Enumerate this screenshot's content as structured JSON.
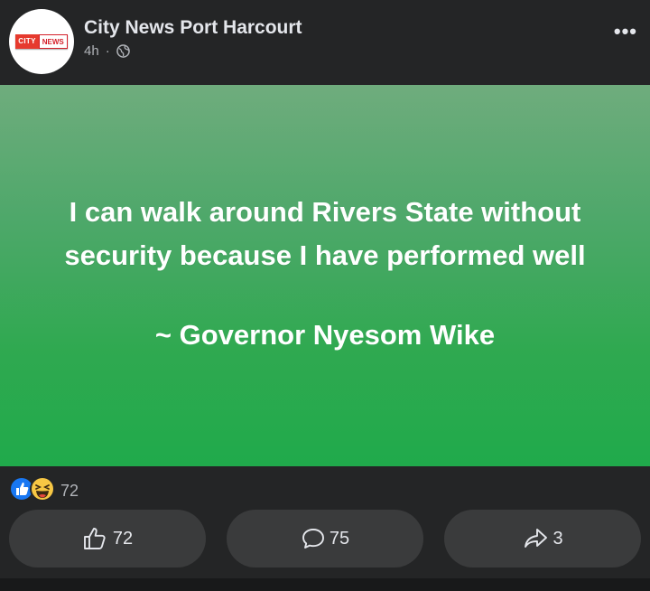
{
  "post": {
    "page_name": "City News Port Harcourt",
    "time": "4h",
    "separator": "·",
    "logo": {
      "part_a": "CITY",
      "part_b": "NEWS"
    },
    "more_label": "•••"
  },
  "quote": {
    "line1": "I can walk around Rivers State without",
    "line2": "security because I have performed well",
    "author": "~ Governor Nyesom Wike"
  },
  "reactions": {
    "icons": [
      "like-icon",
      "haha-icon"
    ],
    "count": "72"
  },
  "actions": {
    "like_count": "72",
    "comment_count": "75",
    "share_count": "3"
  },
  "colors": {
    "background": "#242526",
    "button": "#3a3b3c",
    "quote_green": "#20aa4b",
    "like_blue": "#1877f2"
  }
}
